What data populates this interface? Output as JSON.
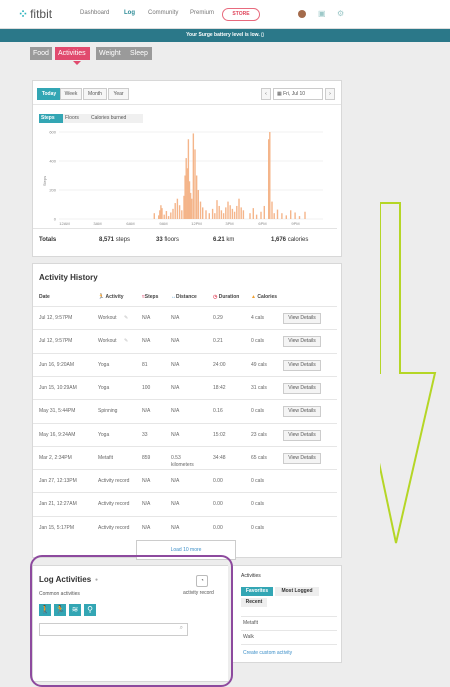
{
  "nav": {
    "logo": "fitbit",
    "links": [
      "Dashboard",
      "Log",
      "Community",
      "Premium"
    ],
    "store_label": "STORE"
  },
  "banner": {
    "text": "Your Surge battery level is low."
  },
  "tabs": [
    "Food",
    "Activities",
    "Weight",
    "Sleep"
  ],
  "day_panel": {
    "range_buttons": [
      "Today",
      "Week",
      "Month",
      "Year"
    ],
    "date": "Fri, Jul 10",
    "metric_tabs": [
      "Steps",
      "Floors",
      "Calories burned"
    ],
    "y_ticks": [
      "600",
      "400",
      "200",
      "0"
    ],
    "ylabel": "Steps",
    "x_ticks": [
      "12AM",
      "3AM",
      "6AM",
      "9AM",
      "12PM",
      "3PM",
      "6PM",
      "9PM"
    ],
    "totals": {
      "label": "Totals",
      "steps": "8,571",
      "steps_unit": "steps",
      "floors": "33",
      "floors_unit": "floors",
      "distance": "6.21",
      "distance_unit": "km",
      "calories": "1,676",
      "calories_unit": "calories"
    }
  },
  "chart_data": {
    "type": "bar",
    "ylabel": "Steps",
    "ylim": [
      0,
      600
    ],
    "x_ticks": [
      "12AM",
      "3AM",
      "6AM",
      "9AM",
      "12PM",
      "3PM",
      "6PM",
      "9PM"
    ],
    "bars": [
      {
        "h": 8.6,
        "v": 40
      },
      {
        "h": 9.0,
        "v": 25
      },
      {
        "h": 9.1,
        "v": 60
      },
      {
        "h": 9.2,
        "v": 95
      },
      {
        "h": 9.3,
        "v": 75
      },
      {
        "h": 9.5,
        "v": 30
      },
      {
        "h": 9.7,
        "v": 55
      },
      {
        "h": 9.9,
        "v": 20
      },
      {
        "h": 10.1,
        "v": 45
      },
      {
        "h": 10.3,
        "v": 70
      },
      {
        "h": 10.5,
        "v": 110
      },
      {
        "h": 10.7,
        "v": 140
      },
      {
        "h": 10.9,
        "v": 95
      },
      {
        "h": 11.1,
        "v": 60
      },
      {
        "h": 11.3,
        "v": 160
      },
      {
        "h": 11.4,
        "v": 300
      },
      {
        "h": 11.5,
        "v": 420
      },
      {
        "h": 11.6,
        "v": 350
      },
      {
        "h": 11.7,
        "v": 550
      },
      {
        "h": 11.8,
        "v": 260
      },
      {
        "h": 11.9,
        "v": 180
      },
      {
        "h": 12.0,
        "v": 140
      },
      {
        "h": 12.15,
        "v": 590
      },
      {
        "h": 12.3,
        "v": 480
      },
      {
        "h": 12.45,
        "v": 300
      },
      {
        "h": 12.6,
        "v": 200
      },
      {
        "h": 12.8,
        "v": 120
      },
      {
        "h": 13.0,
        "v": 80
      },
      {
        "h": 13.3,
        "v": 60
      },
      {
        "h": 13.6,
        "v": 40
      },
      {
        "h": 13.9,
        "v": 70
      },
      {
        "h": 14.1,
        "v": 40
      },
      {
        "h": 14.3,
        "v": 130
      },
      {
        "h": 14.5,
        "v": 90
      },
      {
        "h": 14.7,
        "v": 60
      },
      {
        "h": 14.9,
        "v": 40
      },
      {
        "h": 15.1,
        "v": 80
      },
      {
        "h": 15.3,
        "v": 120
      },
      {
        "h": 15.5,
        "v": 95
      },
      {
        "h": 15.7,
        "v": 70
      },
      {
        "h": 15.9,
        "v": 50
      },
      {
        "h": 16.1,
        "v": 90
      },
      {
        "h": 16.3,
        "v": 140
      },
      {
        "h": 16.5,
        "v": 80
      },
      {
        "h": 16.7,
        "v": 60
      },
      {
        "h": 17.3,
        "v": 40
      },
      {
        "h": 17.6,
        "v": 75
      },
      {
        "h": 17.9,
        "v": 30
      },
      {
        "h": 18.3,
        "v": 50
      },
      {
        "h": 18.6,
        "v": 90
      },
      {
        "h": 19.0,
        "v": 550
      },
      {
        "h": 19.1,
        "v": 600
      },
      {
        "h": 19.3,
        "v": 120
      },
      {
        "h": 19.5,
        "v": 40
      },
      {
        "h": 19.8,
        "v": 65
      },
      {
        "h": 20.2,
        "v": 40
      },
      {
        "h": 20.6,
        "v": 25
      },
      {
        "h": 21.0,
        "v": 60
      },
      {
        "h": 21.4,
        "v": 45
      },
      {
        "h": 21.8,
        "v": 20
      },
      {
        "h": 22.3,
        "v": 50
      }
    ],
    "bar_color": "#f4b58a",
    "grid": true
  },
  "history": {
    "title": "Activity History",
    "headers": [
      "Date",
      "Activity",
      "Steps",
      "Distance",
      "Duration",
      "Calories"
    ],
    "rows": [
      {
        "date": "Jul 12, 9:57PM",
        "activity": "Workout",
        "steps": "N/A",
        "distance": "N/A",
        "distance2": "",
        "duration": "0.29",
        "calories": "4 cals"
      },
      {
        "date": "Jul 12, 9:57PM",
        "activity": "Workout",
        "steps": "N/A",
        "distance": "N/A",
        "distance2": "",
        "duration": "0.21",
        "calories": "0 cals"
      },
      {
        "date": "Jun 16, 9:20AM",
        "activity": "Yoga",
        "steps": "81",
        "distance": "N/A",
        "distance2": "",
        "duration": "24:00",
        "calories": "49 cals"
      },
      {
        "date": "Jun 15, 10:29AM",
        "activity": "Yoga",
        "steps": "100",
        "distance": "N/A",
        "distance2": "",
        "duration": "18:42",
        "calories": "31 cals"
      },
      {
        "date": "May 31, 5:44PM",
        "activity": "Spinning",
        "steps": "N/A",
        "distance": "N/A",
        "distance2": "",
        "duration": "0.16",
        "calories": "0 cals"
      },
      {
        "date": "May 16, 9:24AM",
        "activity": "Yoga",
        "steps": "33",
        "distance": "N/A",
        "distance2": "",
        "duration": "15:02",
        "calories": "23 cals"
      },
      {
        "date": "Mar 2, 2:34PM",
        "activity": "Metafit",
        "steps": "859",
        "distance": "0.53",
        "distance2": "kilometers",
        "duration": "34:48",
        "calories": "65 cals"
      },
      {
        "date": "Jan 27, 12:13PM",
        "activity": "Activity record",
        "steps": "N/A",
        "distance": "N/A",
        "distance2": "",
        "duration": "0.00",
        "calories": "0 cals"
      },
      {
        "date": "Jan 21, 12:27AM",
        "activity": "Activity record",
        "steps": "N/A",
        "distance": "N/A",
        "distance2": "",
        "duration": "0.00",
        "calories": "0 cals"
      },
      {
        "date": "Jan 15, 5:17PM",
        "activity": "Activity record",
        "steps": "N/A",
        "distance": "N/A",
        "distance2": "",
        "duration": "0.00",
        "calories": "0 cals"
      }
    ],
    "view_details": "View Details",
    "load_more": "Load 10 more"
  },
  "log": {
    "title": "Log Activities",
    "record_label": "activity record",
    "common_label": "Common activities",
    "search_placeholder": ""
  },
  "sidepanel": {
    "title": "Activities",
    "tabs": [
      "Favorites",
      "Most Logged",
      "Recent"
    ],
    "items": [
      "Metafit",
      "Walk"
    ],
    "create_link": "Create custom activity"
  },
  "colors": {
    "accent": "#33a6b4",
    "pink": "#e14a6e",
    "banner": "#2b7889",
    "annotation_purple": "#8d4a9e",
    "annotation_green": "#b5d626"
  }
}
